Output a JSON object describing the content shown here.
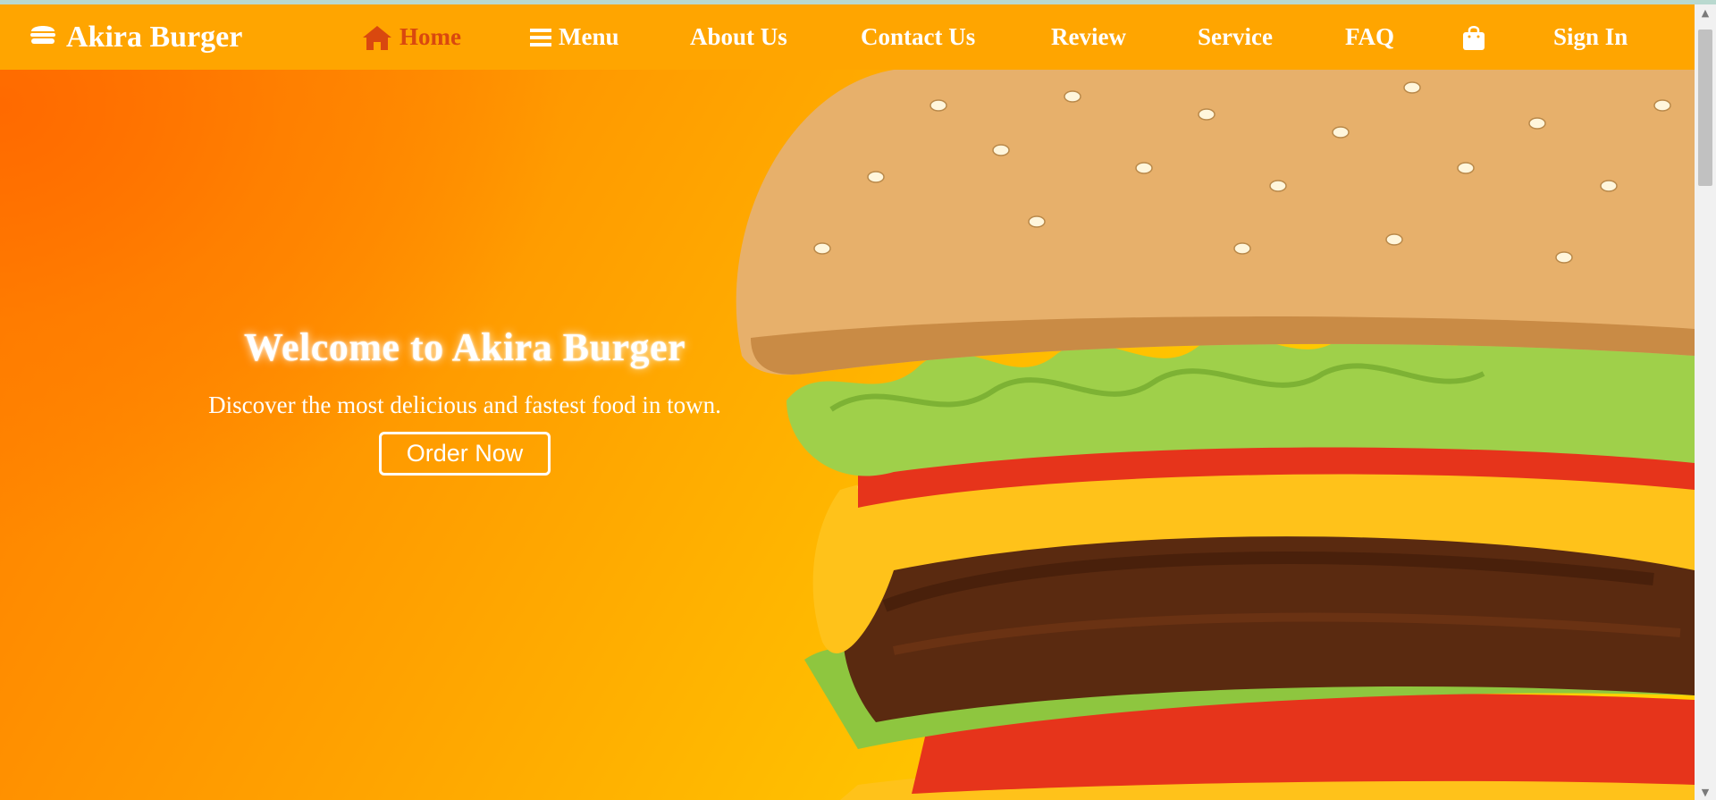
{
  "brand": {
    "name": "Akira Burger",
    "icon": "burger-icon"
  },
  "nav": {
    "home": {
      "label": "Home",
      "icon": "house-icon"
    },
    "menu": {
      "label": "Menu",
      "icon": "bars-icon"
    },
    "about": {
      "label": "About Us"
    },
    "contact": {
      "label": "Contact Us"
    },
    "review": {
      "label": "Review"
    },
    "service": {
      "label": "Service"
    },
    "faq": {
      "label": "FAQ"
    },
    "cart": {
      "icon": "shopping-bag-icon"
    },
    "signin": {
      "label": "Sign In"
    }
  },
  "hero": {
    "title": "Welcome to Akira Burger",
    "subtitle": "Discover the most delicious and fastest food in town.",
    "cta_label": "Order Now"
  },
  "colors": {
    "nav_bg": "#ffa500",
    "active_link": "#d9480f",
    "hero_gradient_start": "#ff6a00",
    "hero_gradient_end": "#ffd200"
  }
}
